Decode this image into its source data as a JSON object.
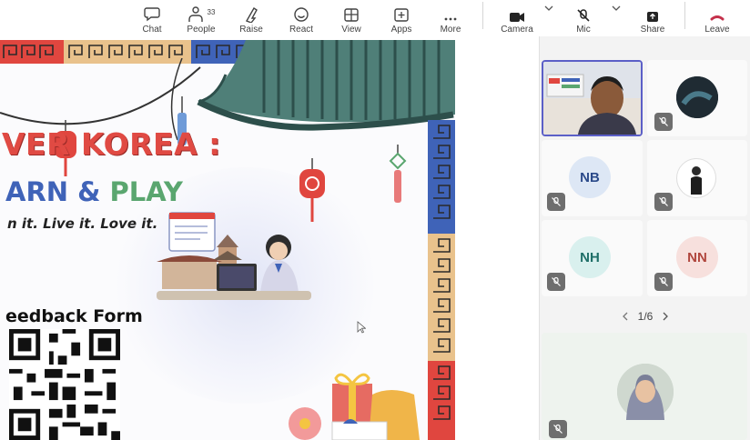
{
  "toolbar": {
    "items": [
      {
        "label": "Chat",
        "icon": "chat-icon"
      },
      {
        "label": "People",
        "icon": "people-icon"
      },
      {
        "label": "Raise",
        "icon": "raise-hand-icon"
      },
      {
        "label": "React",
        "icon": "react-icon"
      },
      {
        "label": "View",
        "icon": "view-icon"
      },
      {
        "label": "Apps",
        "icon": "apps-icon"
      },
      {
        "label": "More",
        "icon": "more-icon"
      },
      {
        "label": "Camera",
        "icon": "camera-icon"
      },
      {
        "label": "Mic",
        "icon": "mic-off-icon"
      },
      {
        "label": "Share",
        "icon": "share-icon"
      },
      {
        "label": "Leave",
        "icon": "leave-icon"
      }
    ],
    "people_count": "33"
  },
  "slide": {
    "title_line1": "VER KOREA :",
    "title_line2_a": "ARN & ",
    "title_line2_b": "PLAY",
    "tagline": "n it. Live it. Love it.",
    "feedback_heading": "eedback Form"
  },
  "participants": {
    "tiles": [
      {
        "kind": "video",
        "name": ""
      },
      {
        "kind": "photo",
        "name": ""
      },
      {
        "kind": "initials",
        "initials": "NB",
        "color": "#dde7f5",
        "text_color": "#2b4a8a"
      },
      {
        "kind": "photo",
        "name": ""
      },
      {
        "kind": "initials",
        "initials": "NH",
        "color": "#d9f0ee",
        "text_color": "#1f6f68"
      },
      {
        "kind": "initials",
        "initials": "NN",
        "color": "#f7e0dd",
        "text_color": "#b0463d"
      },
      {
        "kind": "photo",
        "name": ""
      }
    ],
    "pager": "1/6"
  },
  "colors": {
    "accent": "#5b5fc7",
    "leave": "#c4314b",
    "title_red": "#e04a43",
    "title_blue": "#3f63b8",
    "title_green": "#5aa66f"
  }
}
